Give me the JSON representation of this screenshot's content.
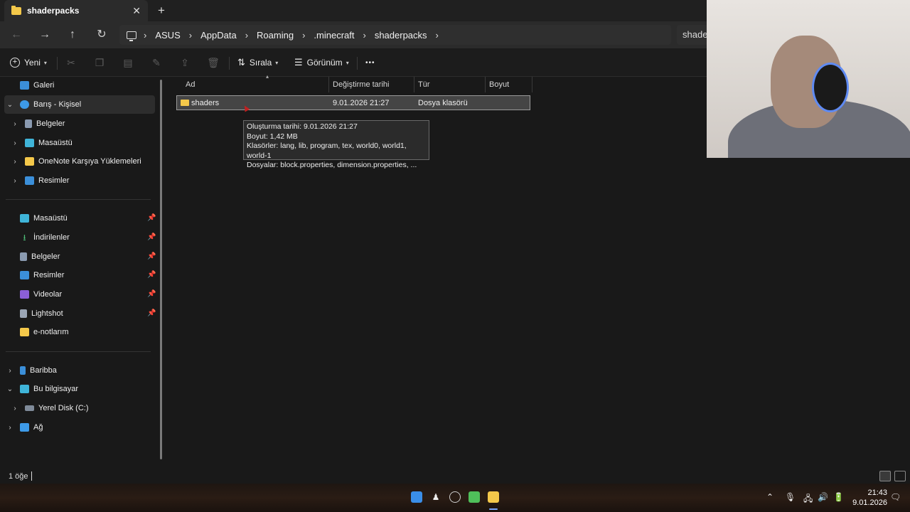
{
  "window": {
    "tab_title": "shaderpacks",
    "tab_close": "✕",
    "new_tab": "+"
  },
  "nav": {
    "back": "←",
    "forward": "→",
    "up": "↑",
    "refresh": "↻",
    "breadcrumb": [
      "ASUS",
      "AppData",
      "Roaming",
      ".minecraft",
      "shaderpacks"
    ],
    "crumb_sep": "›",
    "search_text": "shader"
  },
  "toolbar": {
    "new_label": "Yeni",
    "sort_label": "Sırala",
    "view_label": "Görünüm",
    "more_label": "•••"
  },
  "sidebar": {
    "gallery": "Galeri",
    "personal": "Barış - Kişisel",
    "personal_items": [
      "Belgeler",
      "Masaüstü",
      "OneNote Karşıya Yüklemeleri",
      "Resimler"
    ],
    "quick_access": [
      "Masaüstü",
      "İndirilenler",
      "Belgeler",
      "Resimler",
      "Videolar",
      "Lightshot",
      "e-notlarım"
    ],
    "bottom_items": [
      "Baribba",
      "Bu bilgisayar",
      "Yerel Disk (C:)",
      "Ağ"
    ]
  },
  "columns": {
    "name": "Ad",
    "modified": "Değiştirme tarihi",
    "type": "Tür",
    "size": "Boyut"
  },
  "files": [
    {
      "name": "shaders",
      "modified": "9.01.2026 21:27",
      "type": "Dosya klasörü",
      "size": ""
    }
  ],
  "tooltip": {
    "line1": "Oluşturma tarihi: 9.01.2026 21:27",
    "line2": "Boyut: 1,42 MB",
    "line3": "Klasörler: lang, lib, program, tex, world0, world1, world-1",
    "line4": "Dosyalar: block.properties, dimension.properties, ..."
  },
  "status": {
    "item_count": "1 öğe"
  },
  "taskbar": {
    "time": "21:43",
    "date": "9.01.2026"
  },
  "colors": {
    "folder": "#f4c84a",
    "accent": "#5f8af2"
  }
}
